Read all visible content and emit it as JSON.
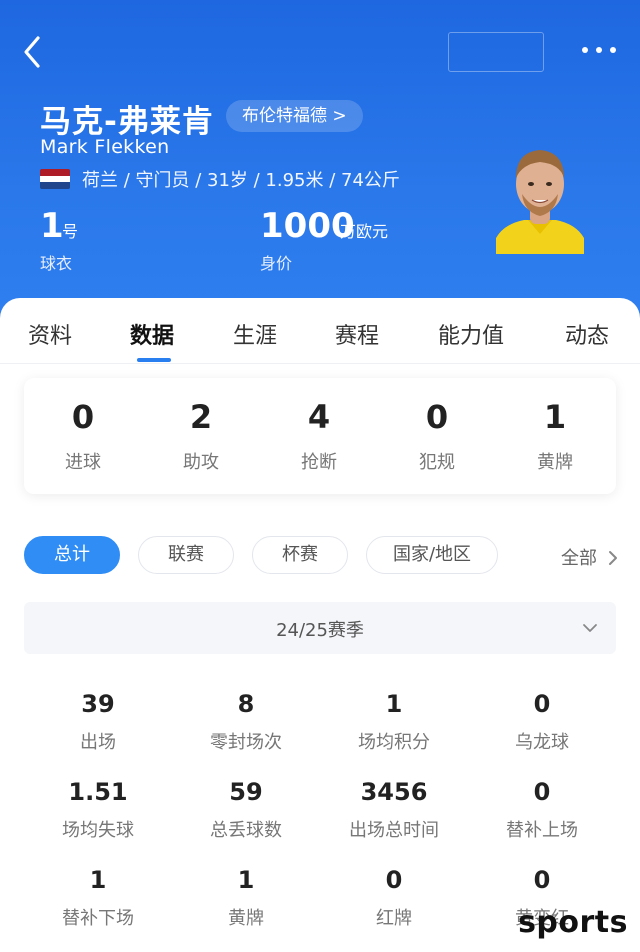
{
  "header": {
    "name_cn": "马克-弗莱肯",
    "team": "布伦特福德 >",
    "name_en": "Mark Flekken",
    "info": "荷兰 / 守门员 / 31岁 / 1.95米 / 74公斤",
    "shirt_number": "1",
    "shirt_unit": "号",
    "shirt_label": "球衣",
    "value": "1000",
    "value_unit": "万欧元",
    "value_label": "身价",
    "flag_colors": [
      "#ae1c28",
      "#ffffff",
      "#21468b"
    ]
  },
  "tabs": [
    {
      "label": "资料"
    },
    {
      "label": "数据"
    },
    {
      "label": "生涯"
    },
    {
      "label": "赛程"
    },
    {
      "label": "能力值"
    },
    {
      "label": "动态"
    }
  ],
  "summary": [
    {
      "value": "0",
      "label": "进球"
    },
    {
      "value": "2",
      "label": "助攻"
    },
    {
      "value": "4",
      "label": "抢断"
    },
    {
      "value": "0",
      "label": "犯规"
    },
    {
      "value": "1",
      "label": "黄牌"
    }
  ],
  "filters": [
    {
      "label": "总计"
    },
    {
      "label": "联赛"
    },
    {
      "label": "杯赛"
    },
    {
      "label": "国家/地区"
    }
  ],
  "all_label": "全部",
  "season": "24/25赛季",
  "stats": [
    {
      "value": "39",
      "label": "出场"
    },
    {
      "value": "8",
      "label": "零封场次"
    },
    {
      "value": "1",
      "label": "场均积分"
    },
    {
      "value": "0",
      "label": "乌龙球"
    },
    {
      "value": "1.51",
      "label": "场均失球"
    },
    {
      "value": "59",
      "label": "总丢球数"
    },
    {
      "value": "3456",
      "label": "出场总时间"
    },
    {
      "value": "0",
      "label": "替补上场"
    },
    {
      "value": "1",
      "label": "替补下场"
    },
    {
      "value": "1",
      "label": "黄牌"
    },
    {
      "value": "0",
      "label": "红牌"
    },
    {
      "value": "0",
      "label": "黄变红"
    }
  ],
  "watermark": "sports",
  "colors": {
    "accent": "#2f8df5",
    "header": "#2a78ea"
  }
}
